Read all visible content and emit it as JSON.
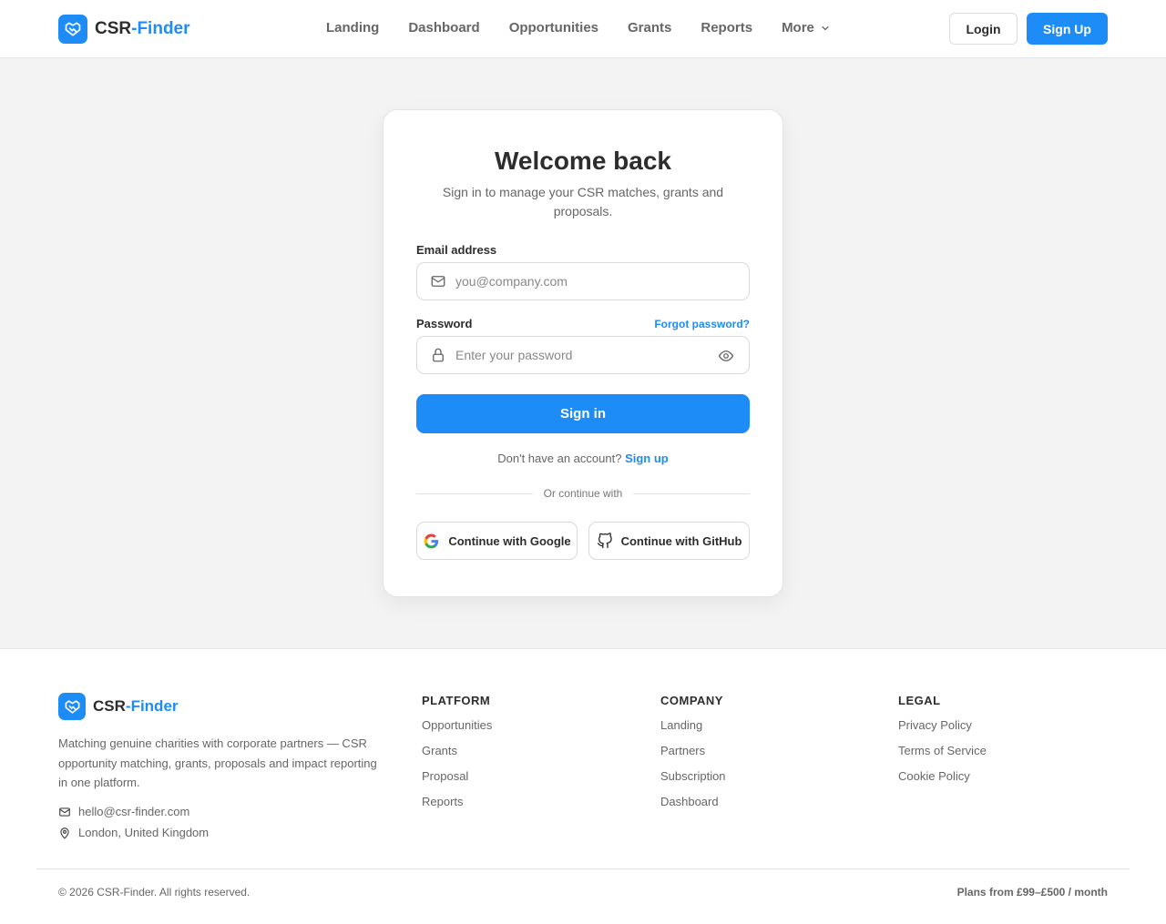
{
  "brand": {
    "name_main": "CSR",
    "name_accent": "-Finder",
    "accent_color": "#1e8cf7",
    "logo_icon": "handshake-icon"
  },
  "nav": {
    "items": [
      "Landing",
      "Dashboard",
      "Opportunities",
      "Grants",
      "Reports"
    ],
    "more_label": "More",
    "login_label": "Login",
    "signup_label": "Sign Up"
  },
  "card": {
    "title": "Welcome back",
    "subtitle": "Sign in to manage your CSR matches, grants and proposals.",
    "email_label": "Email address",
    "email_placeholder": "you@company.com",
    "password_label": "Password",
    "forgot_label": "Forgot password?",
    "password_placeholder": "Enter your password",
    "signin_label": "Sign in",
    "no_account_text": "Don't have an account?",
    "signup_link": "Sign up",
    "divider_text": "Or continue with",
    "google_label": "Continue with Google",
    "github_label": "Continue with GitHub"
  },
  "footer": {
    "description": "Matching genuine charities with corporate partners — CSR opportunity matching, grants, proposals and impact reporting in one platform.",
    "email": "hello@csr-finder.com",
    "location": "London, United Kingdom",
    "columns": [
      {
        "title": "PLATFORM",
        "links": [
          "Opportunities",
          "Grants",
          "Proposal",
          "Reports"
        ]
      },
      {
        "title": "COMPANY",
        "links": [
          "Landing",
          "Partners",
          "Subscription",
          "Dashboard"
        ]
      },
      {
        "title": "LEGAL",
        "links": [
          "Privacy Policy",
          "Terms of Service",
          "Cookie Policy"
        ]
      }
    ],
    "copyright": "© 2026 CSR-Finder. All rights reserved.",
    "plans": "Plans from £99–£500 / month"
  }
}
